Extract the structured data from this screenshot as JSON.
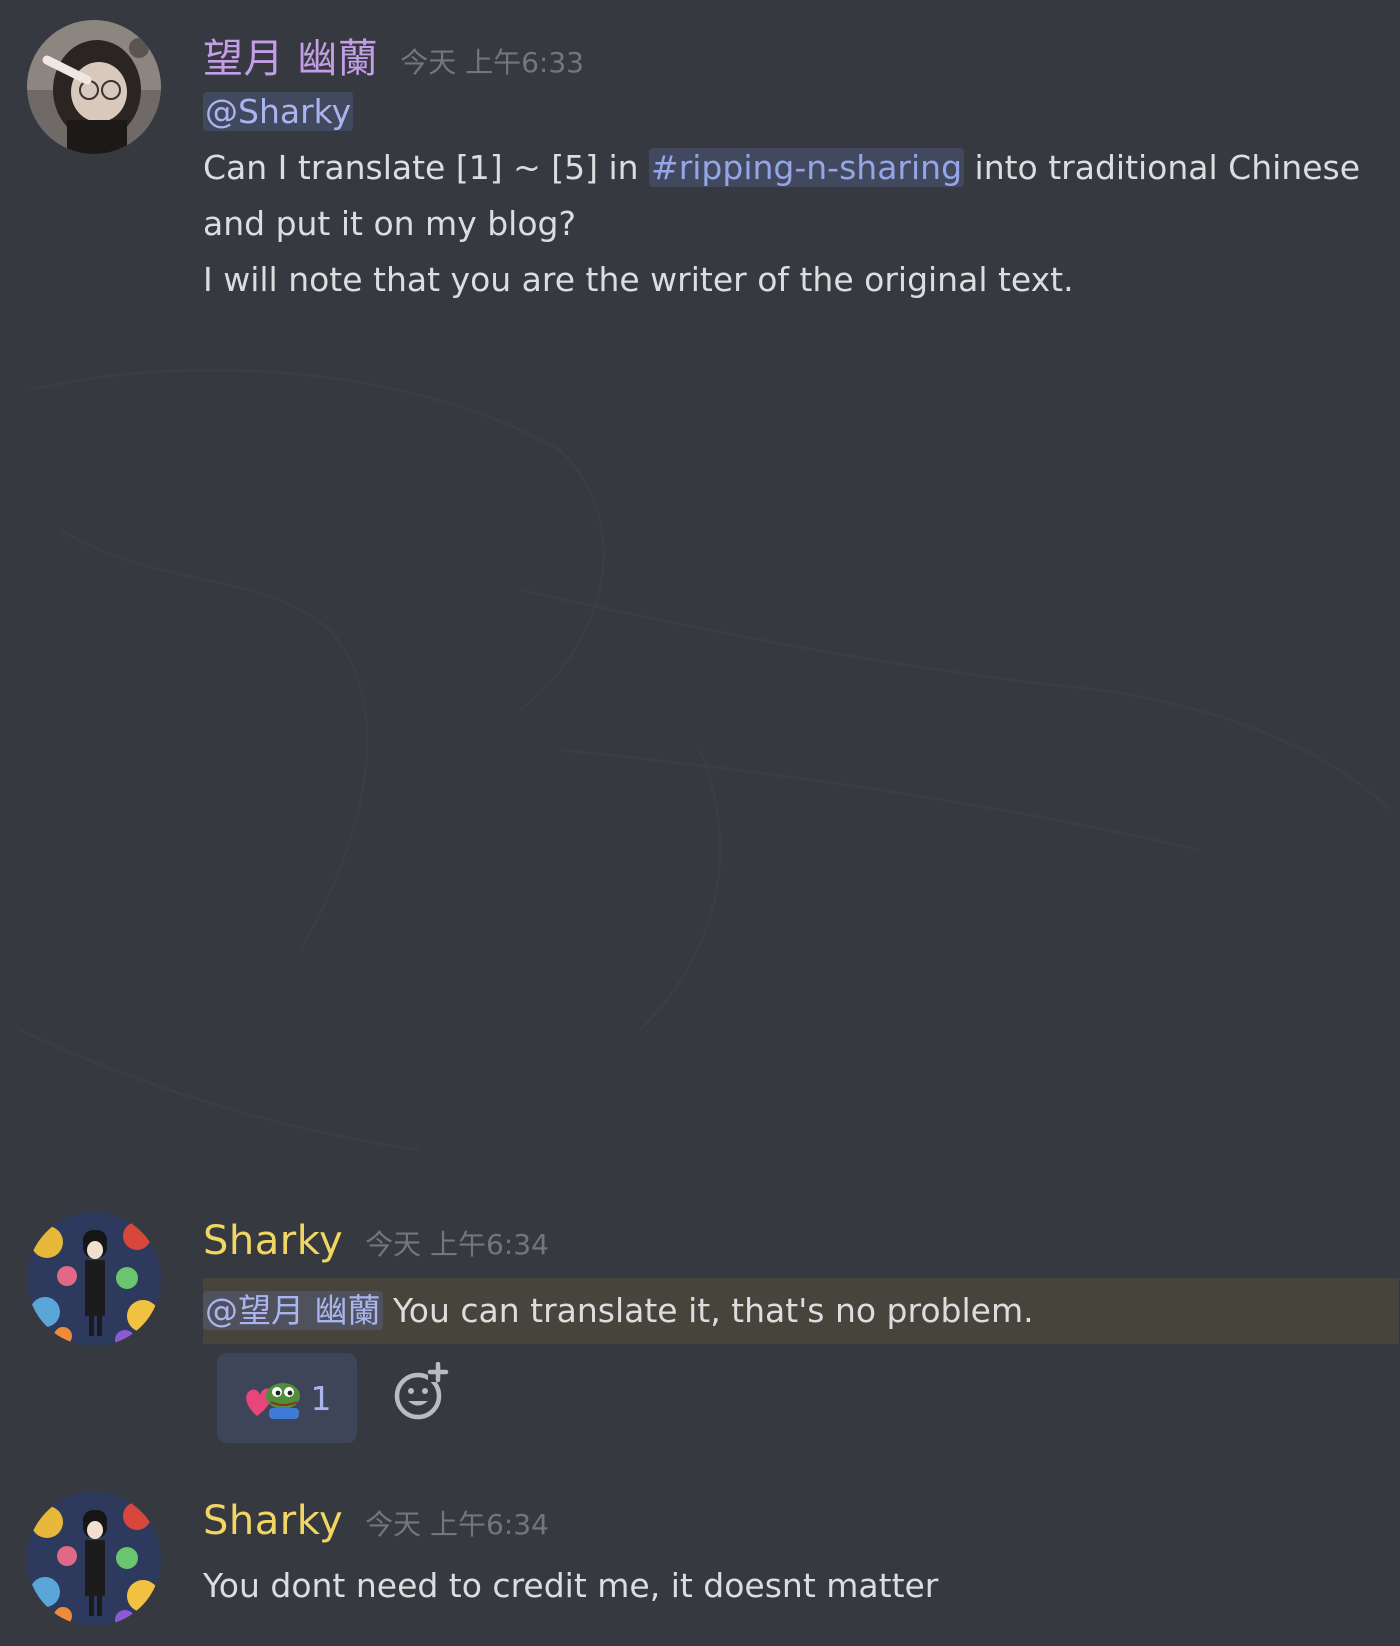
{
  "messages": [
    {
      "author": "望月 幽蘭",
      "author_color": "#c39ee6",
      "timestamp": "今天 上午6:33",
      "mention": "@Sharky",
      "line1_before": "Can I translate [1] ~ [5] in ",
      "channel": "#ripping-n-sharing",
      "line1_after": " into traditional Chinese",
      "line2": "and put it on my blog?",
      "line3": "I will note that you are the writer of the original text."
    },
    {
      "author": "Sharky",
      "author_color": "#f1d662",
      "timestamp": "今天 上午6:34",
      "mention": "@望月 幽蘭",
      "text": " You can translate it, that's no problem.",
      "reaction": {
        "emoji_icon": "pepe-heart-icon",
        "count": "1"
      },
      "add_reaction_icon": "add-reaction-icon"
    },
    {
      "author": "Sharky",
      "author_color": "#f1d662",
      "timestamp": "今天 上午6:34",
      "text": "You dont need to credit me, it doesnt matter"
    }
  ],
  "colors": {
    "background": "#36393f",
    "mention_highlight": "#47443c",
    "timestamp": "#72767d",
    "reaction_bg": "#3f4559"
  }
}
